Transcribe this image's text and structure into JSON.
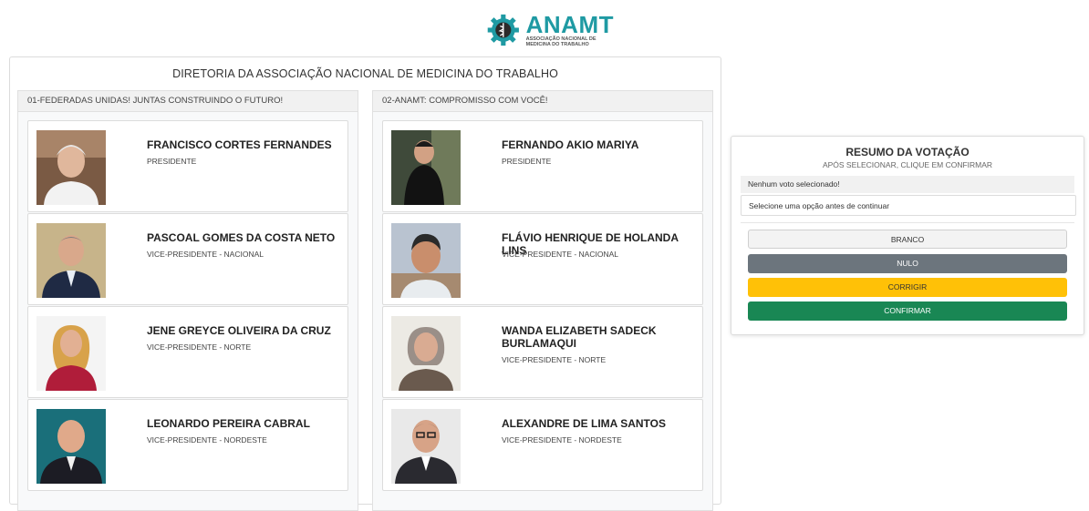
{
  "logo": {
    "title": "ANAMT",
    "subtitle": "ASSOCIAÇÃO NACIONAL DE MEDICINA DO TRABALHO",
    "color": "#1f9aa3"
  },
  "ballot": {
    "title": "DIRETORIA DA ASSOCIAÇÃO NACIONAL DE MEDICINA DO TRABALHO",
    "slates": [
      {
        "label": "01-FEDERADAS UNIDAS! JUNTAS CONSTRUINDO O FUTURO!",
        "candidates": [
          {
            "name": "FRANCISCO CORTES FERNANDES",
            "role": "PRESIDENTE"
          },
          {
            "name": "PASCOAL GOMES DA COSTA NETO",
            "role": "VICE-PRESIDENTE - NACIONAL"
          },
          {
            "name": "JENE GREYCE OLIVEIRA DA CRUZ",
            "role": "VICE-PRESIDENTE - NORTE"
          },
          {
            "name": "LEONARDO PEREIRA CABRAL",
            "role": "VICE-PRESIDENTE - NORDESTE"
          }
        ]
      },
      {
        "label": "02-ANAMT: COMPROMISSO COM VOCÊ!",
        "candidates": [
          {
            "name": "FERNANDO AKIO MARIYA",
            "role": "PRESIDENTE"
          },
          {
            "name": "FLÁVIO HENRIQUE DE HOLANDA LINS",
            "role": "VICE-PRESIDENTE - NACIONAL"
          },
          {
            "name": "WANDA ELIZABETH SADECK BURLAMAQUI",
            "role": "VICE-PRESIDENTE - NORTE"
          },
          {
            "name": "ALEXANDRE DE LIMA SANTOS",
            "role": "VICE-PRESIDENTE - NORDESTE"
          }
        ]
      }
    ]
  },
  "summary": {
    "title": "RESUMO DA VOTAÇÃO",
    "subtitle": "APÓS SELECIONAR, CLIQUE EM CONFIRMAR",
    "status": "Nenhum voto selecionado!",
    "message": "Selecione uma opção antes de continuar",
    "buttons": {
      "branco": "BRANCO",
      "nulo": "NULO",
      "corrigir": "CORRIGIR",
      "confirmar": "CONFIRMAR"
    }
  },
  "colors": {
    "nulo": "#6c757d",
    "corrigir": "#ffc107",
    "confirmar": "#198754"
  }
}
